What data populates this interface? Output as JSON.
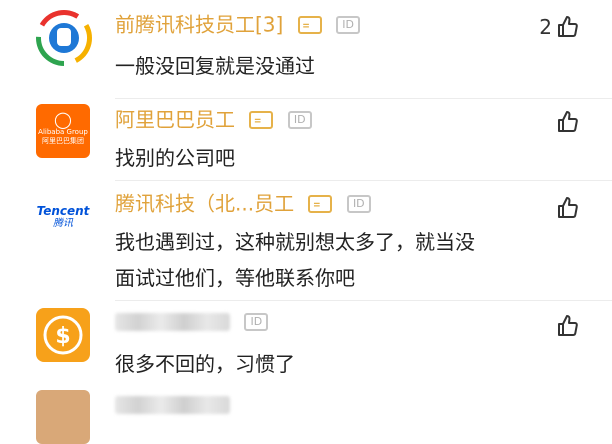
{
  "comments": [
    {
      "name": "前腾讯科技员工[3]",
      "text_lines": [
        "一般没回复就是没通过"
      ],
      "likes": "2",
      "avatar": "tencent-news-logo"
    },
    {
      "name": "阿里巴巴员工",
      "text_lines": [
        "找别的公司吧"
      ],
      "likes": "",
      "avatar": "alibaba-group-logo",
      "avatar_text": {
        "line1": "Alibaba Group",
        "line2": "阿里巴巴集团"
      }
    },
    {
      "name": "腾讯科技（北...员工",
      "text_lines": [
        "我也遇到过，这种就别想太多了，就当没",
        "面试过他们，等他联系你吧"
      ],
      "likes": "",
      "avatar": "tencent-logo",
      "avatar_text": {
        "line1": "Tencent",
        "line2": "腾讯"
      }
    },
    {
      "name": "",
      "text_lines": [
        "很多不回的，习惯了"
      ],
      "likes": "",
      "avatar": "dollar-coin-icon"
    }
  ],
  "badges": {
    "id_label": "ID"
  },
  "colors": {
    "name": "#e0a23a",
    "alibaba": "#ff6a00",
    "tencent_blue": "#0052d9",
    "coin_orange": "#f7a11a"
  }
}
